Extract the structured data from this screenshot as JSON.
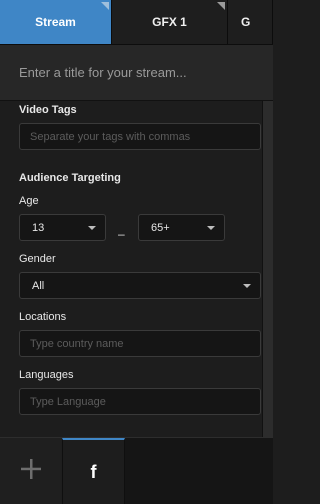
{
  "tabs": [
    {
      "label": "Stream",
      "active": true
    },
    {
      "label": "GFX 1",
      "active": false
    },
    {
      "label": "G",
      "active": false
    }
  ],
  "title_bar": {
    "placeholder": "Enter a title for your stream..."
  },
  "video_tags": {
    "label": "Video Tags",
    "placeholder": "Separate your tags with commas"
  },
  "audience": {
    "heading": "Audience Targeting",
    "age": {
      "label": "Age",
      "min": "13",
      "max": "65+",
      "separator": "–"
    },
    "gender": {
      "label": "Gender",
      "value": "All"
    },
    "locations": {
      "label": "Locations",
      "placeholder": "Type country name"
    },
    "languages": {
      "label": "Languages",
      "placeholder": "Type Language"
    }
  },
  "footer": {
    "add_symbol": "+",
    "facebook_symbol": "f"
  },
  "colors": {
    "accent": "#3f86c6",
    "background": "#1d1d1d",
    "field": "#151515"
  }
}
